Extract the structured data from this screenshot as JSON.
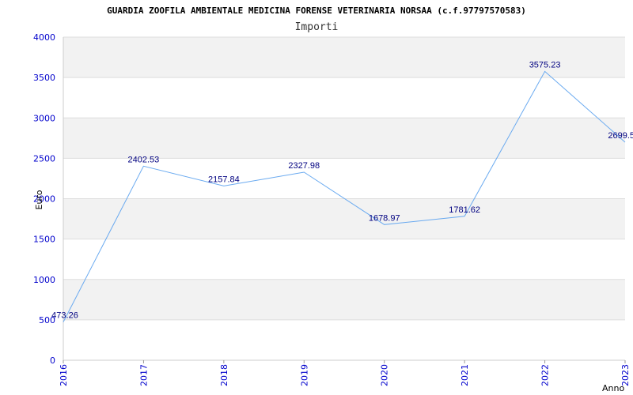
{
  "chart_data": {
    "type": "line",
    "title": "GUARDIA ZOOFILA AMBIENTALE MEDICINA FORENSE VETERINARIA NORSAA (c.f.97797570583)",
    "subtitle": "Importi",
    "xlabel": "Anno",
    "ylabel": "Euro",
    "x": [
      "2016",
      "2017",
      "2018",
      "2019",
      "2020",
      "2021",
      "2022",
      "2023"
    ],
    "series": [
      {
        "values": [
          473.26,
          2402.53,
          2157.84,
          2327.98,
          1678.97,
          1781.62,
          3575.23,
          2699.5
        ],
        "data_labels": [
          "473.26",
          "2402.53",
          "2157.84",
          "2327.98",
          "1678.97",
          "1781.62",
          "3575.23",
          "2699.5"
        ]
      }
    ],
    "ylim": [
      0,
      4000
    ],
    "yticks": [
      "0",
      "500",
      "1000",
      "1500",
      "2000",
      "2500",
      "3000",
      "3500",
      "4000"
    ],
    "grid": true,
    "colors": {
      "line": "#6aaaf0",
      "band": "#f2f2f2",
      "grid": "#dddddd",
      "ticks": "#0000cc",
      "data_labels": "#000080"
    }
  }
}
